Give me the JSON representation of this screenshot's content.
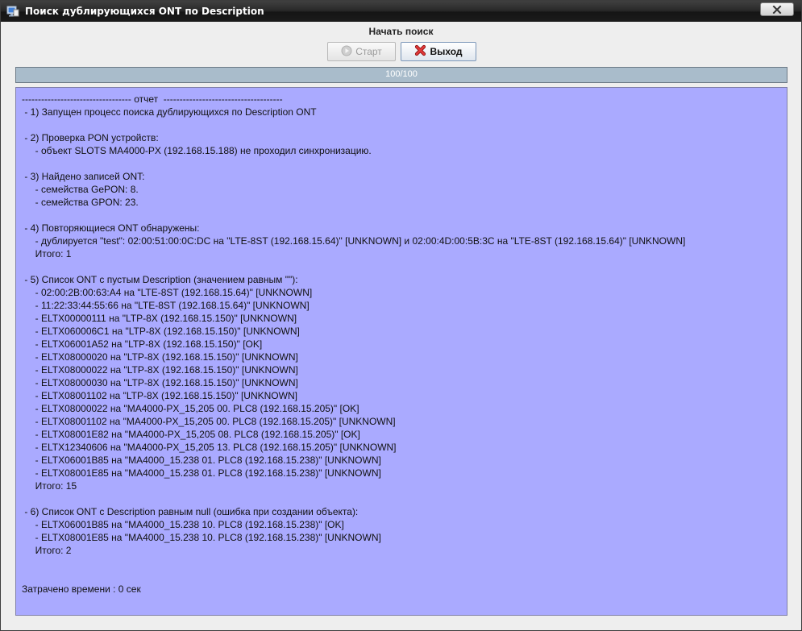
{
  "window": {
    "title": "Поиск дублирующихся ONT по Description",
    "app_icon": "monitor-app-icon",
    "close_icon": "close-x-icon"
  },
  "toolbar": {
    "heading": "Начать поиск",
    "start_label": "Старт",
    "start_icon": "play-disabled-icon",
    "exit_label": "Выход",
    "exit_icon": "red-x-icon"
  },
  "progress": {
    "text": "100/100",
    "fraction": 1.0
  },
  "colors": {
    "report_bg": "#aaaaff",
    "progress_bg": "#a9bccb",
    "exit_icon_red": "#d02020"
  },
  "report": {
    "lines": [
      "---------------------------------- отчет  -------------------------------------",
      " - 1) Запущен процесс поиска дублирующихся по Description ONT",
      "",
      " - 2) Проверка PON устройств:",
      "     - объект SLOTS MA4000-PX (192.168.15.188) не проходил синхронизацию.",
      "",
      " - 3) Найдено записей ONT:",
      "     - семейства GePON: 8.",
      "     - семейства GPON: 23.",
      "",
      " - 4) Повторяющиеся ONT обнаружены:",
      "     - дублируется \"test\": 02:00:51:00:0C:DC на \"LTE-8ST (192.168.15.64)\" [UNKNOWN] и 02:00:4D:00:5B:3C на \"LTE-8ST (192.168.15.64)\" [UNKNOWN]",
      "     Итого: 1",
      "",
      " - 5) Список ONT с пустым Description (значением равным \"\"):",
      "     - 02:00:2B:00:63:A4 на \"LTE-8ST (192.168.15.64)\" [UNKNOWN]",
      "     - 11:22:33:44:55:66 на \"LTE-8ST (192.168.15.64)\" [UNKNOWN]",
      "     - ELTX00000111 на \"LTP-8X (192.168.15.150)\" [UNKNOWN]",
      "     - ELTX060006C1 на \"LTP-8X (192.168.15.150)\" [UNKNOWN]",
      "     - ELTX06001A52 на \"LTP-8X (192.168.15.150)\" [OK]",
      "     - ELTX08000020 на \"LTP-8X (192.168.15.150)\" [UNKNOWN]",
      "     - ELTX08000022 на \"LTP-8X (192.168.15.150)\" [UNKNOWN]",
      "     - ELTX08000030 на \"LTP-8X (192.168.15.150)\" [UNKNOWN]",
      "     - ELTX08001102 на \"LTP-8X (192.168.15.150)\" [UNKNOWN]",
      "     - ELTX08000022 на \"MA4000-PX_15,205 00. PLC8 (192.168.15.205)\" [OK]",
      "     - ELTX08001102 на \"MA4000-PX_15,205 00. PLC8 (192.168.15.205)\" [UNKNOWN]",
      "     - ELTX08001E82 на \"MA4000-PX_15,205 08. PLC8 (192.168.15.205)\" [OK]",
      "     - ELTX12340606 на \"MA4000-PX_15,205 13. PLC8 (192.168.15.205)\" [UNKNOWN]",
      "     - ELTX06001B85 на \"MA4000_15.238 01. PLC8 (192.168.15.238)\" [UNKNOWN]",
      "     - ELTX08001E85 на \"MA4000_15.238 01. PLC8 (192.168.15.238)\" [UNKNOWN]",
      "     Итого: 15",
      "",
      " - 6) Список ONT с Description равным null (ошибка при создании объекта):",
      "     - ELTX06001B85 на \"MA4000_15.238 10. PLC8 (192.168.15.238)\" [OK]",
      "     - ELTX08001E85 на \"MA4000_15.238 10. PLC8 (192.168.15.238)\" [UNKNOWN]",
      "     Итого: 2",
      "",
      "",
      "Затрачено времени : 0 сек"
    ]
  }
}
